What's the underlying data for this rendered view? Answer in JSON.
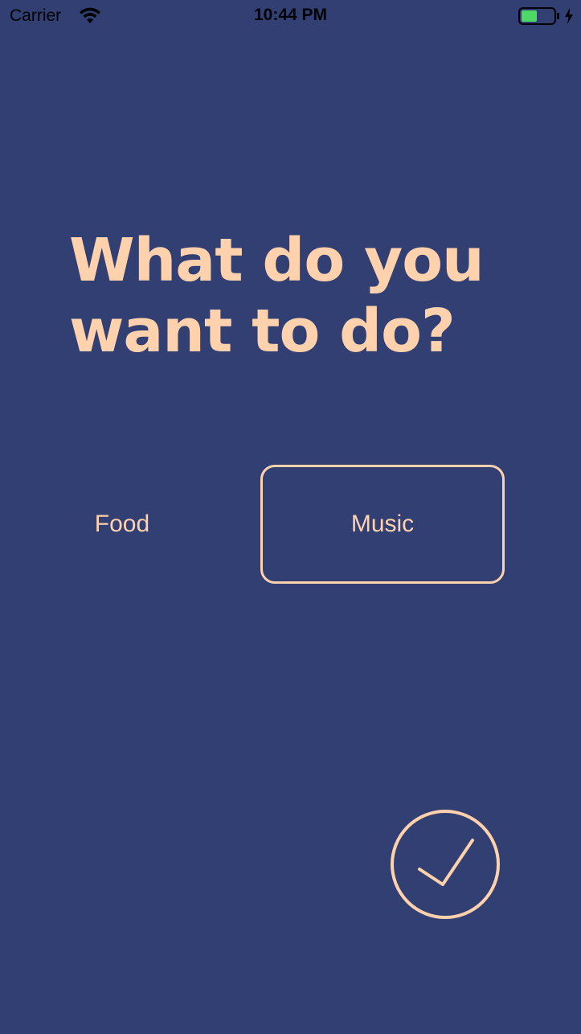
{
  "status_bar": {
    "carrier": "Carrier",
    "time": "10:44 PM",
    "wifi_icon": "wifi-icon",
    "battery_icon": "battery-icon",
    "charging_icon": "charging-bolt-icon"
  },
  "prompt": {
    "line1": "What do you",
    "line2": "want to do?"
  },
  "options": [
    {
      "label": "Food",
      "selected": false
    },
    {
      "label": "Music",
      "selected": true
    }
  ],
  "confirm": {
    "icon": "checkmark-icon"
  },
  "colors": {
    "background": "#323f72",
    "accent": "#ffd2ad",
    "battery_level": "#4cd964"
  }
}
